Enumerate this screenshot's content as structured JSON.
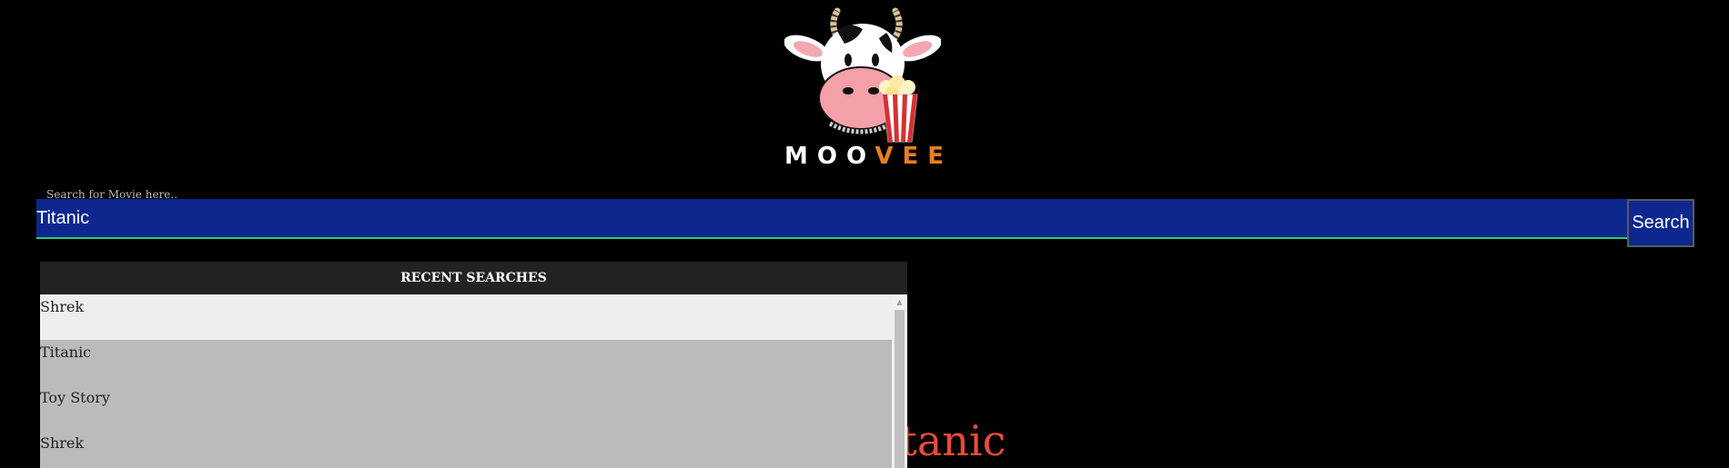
{
  "logo": {
    "text_moo": "MOO",
    "text_vee": "VEE",
    "colors": {
      "moo": "#ffffff",
      "vee": "#e67e22"
    },
    "icon": "cow-with-popcorn-logo"
  },
  "search": {
    "label": "Search for Movie here..",
    "value": "Titanic",
    "button_label": "Search",
    "colors": {
      "background": "#0d278f",
      "underline": "#2ecc71"
    }
  },
  "recent": {
    "header": "RECENT SEARCHES",
    "items": [
      {
        "label": "Shrek"
      },
      {
        "label": "Titanic"
      },
      {
        "label": "Toy Story"
      },
      {
        "label": "Shrek"
      }
    ],
    "scroll_up_icon": "scroll-up-arrow-icon"
  },
  "result": {
    "title": "Titanic",
    "color": "#e74c3c"
  }
}
